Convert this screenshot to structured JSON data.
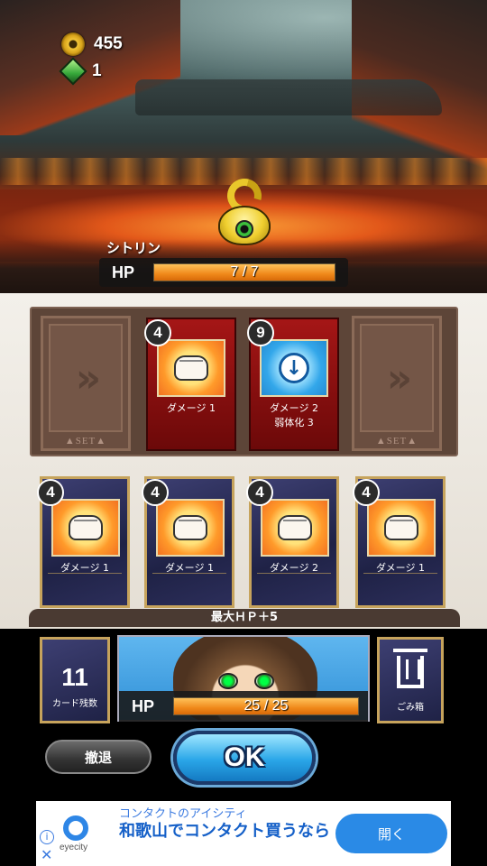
{
  "currency": {
    "gold": "455",
    "gems": "1"
  },
  "enemy": {
    "name": "シトリン",
    "hp_label": "HP",
    "hp_text": "7 / 7",
    "hp_fraction": 1.0
  },
  "set_slots": {
    "label": "SET"
  },
  "set_cards": [
    {
      "cost": "4",
      "name": "ダメージ 1",
      "sub": ""
    },
    {
      "cost": "9",
      "name": "ダメージ 2",
      "sub": "弱体化 3"
    }
  ],
  "hand_cards": [
    {
      "cost": "4",
      "name": "ダメージ 1"
    },
    {
      "cost": "4",
      "name": "ダメージ 1"
    },
    {
      "cost": "4",
      "name": "ダメージ 2"
    },
    {
      "cost": "4",
      "name": "ダメージ 1"
    }
  ],
  "bonus_text": "最大ＨＰ＋5",
  "deck": {
    "count": "11",
    "label": "カード残数"
  },
  "player": {
    "hp_label": "HP",
    "hp_text": "25 / 25",
    "hp_fraction": 1.0
  },
  "trash": {
    "label": "ごみ箱"
  },
  "buttons": {
    "retreat": "撤退",
    "ok": "OK"
  },
  "ad": {
    "small_text": "コンタクトのアイシティ",
    "headline": "和歌山でコンタクト買うなら",
    "brand": "eyecity",
    "cta": "開く",
    "info_glyph": "i",
    "close_glyph": "✕"
  },
  "icons": {
    "gold": "coin-icon",
    "gems": "gem-icon",
    "punch": "fist-icon",
    "debuff": "down-arrow-icon",
    "trash": "trash-icon",
    "set_arrow": "chevron-right-icon"
  },
  "colors": {
    "hp_fill": "#f0891a",
    "ok_button": "#2aa6e8",
    "card_frame_gold": "#c6a35c",
    "ad_blue": "#2a8ae6"
  }
}
